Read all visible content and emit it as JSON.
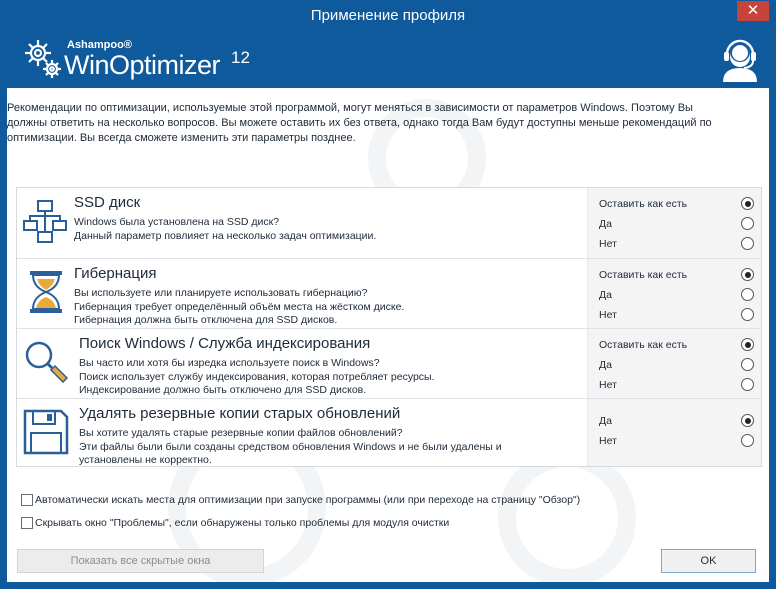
{
  "window": {
    "title": "Применение профиля",
    "close_glyph": "✕"
  },
  "brand": {
    "company": "Ashampoo®",
    "product": "WinOptimizer",
    "version": "12"
  },
  "intro": "Рекомендации по оптимизации, используемые этой программой, могут меняться в зависимости от параметров Windows. Поэтому Вы должны ответить на несколько вопросов. Вы можете оставить их без ответа, однако тогда Вам будут доступны меньше рекомендаций по оптимизации. Вы всегда сможете изменить эти параметры позднее.",
  "sections": [
    {
      "icon": "network-computers-icon",
      "title": "SSD диск",
      "lines": [
        "Windows была установлена на SSD диск?",
        "Данный параметр повлияет на несколько задач оптимизации."
      ],
      "options": [
        {
          "label": "Оставить как есть",
          "checked": true
        },
        {
          "label": "Да",
          "checked": false
        },
        {
          "label": "Нет",
          "checked": false
        }
      ]
    },
    {
      "icon": "hourglass-icon",
      "title": "Гибернация",
      "lines": [
        "Вы используете или планируете использовать гибернацию?",
        "Гибернация требует определённый объём места на жёстком диске.",
        "Гибернация должна быть отключена для SSD дисков."
      ],
      "options": [
        {
          "label": "Оставить как есть",
          "checked": true
        },
        {
          "label": "Да",
          "checked": false
        },
        {
          "label": "Нет",
          "checked": false
        }
      ]
    },
    {
      "icon": "magnifier-icon",
      "title": "Поиск Windows / Служба индексирования",
      "lines": [
        "Вы часто или хотя бы изредка используете поиск в Windows?",
        "Поиск использует службу индексирования, которая потребляет ресурсы.",
        "Индексирование должно быть отключено для SSD дисков."
      ],
      "options": [
        {
          "label": "Оставить как есть",
          "checked": true
        },
        {
          "label": "Да",
          "checked": false
        },
        {
          "label": "Нет",
          "checked": false
        }
      ]
    },
    {
      "icon": "floppy-disk-icon",
      "title": "Удалять резервные копии старых обновлений",
      "lines": [
        "Вы хотите удалять старые резервные копии файлов обновлений?",
        "Эти файлы были были созданы средством обновления Windows и не были удалены и",
        "установлены не корректно."
      ],
      "options": [
        {
          "label": "Да",
          "checked": true
        },
        {
          "label": "Нет",
          "checked": false
        }
      ]
    }
  ],
  "checkboxes": [
    {
      "label": "Автоматически искать места для оптимизации при запуске программы (или при переходе на страницу \"Обзор\")",
      "checked": false
    },
    {
      "label": "Скрывать окно \"Проблемы\", если обнаружены только проблемы для модуля очистки",
      "checked": false
    }
  ],
  "buttons": {
    "show_hidden": "Показать все скрытые окна",
    "ok": "OK"
  },
  "colors": {
    "titlebar": "#0f5a9c",
    "close": "#c7443a",
    "radio_panel": "#f4f4f4"
  }
}
